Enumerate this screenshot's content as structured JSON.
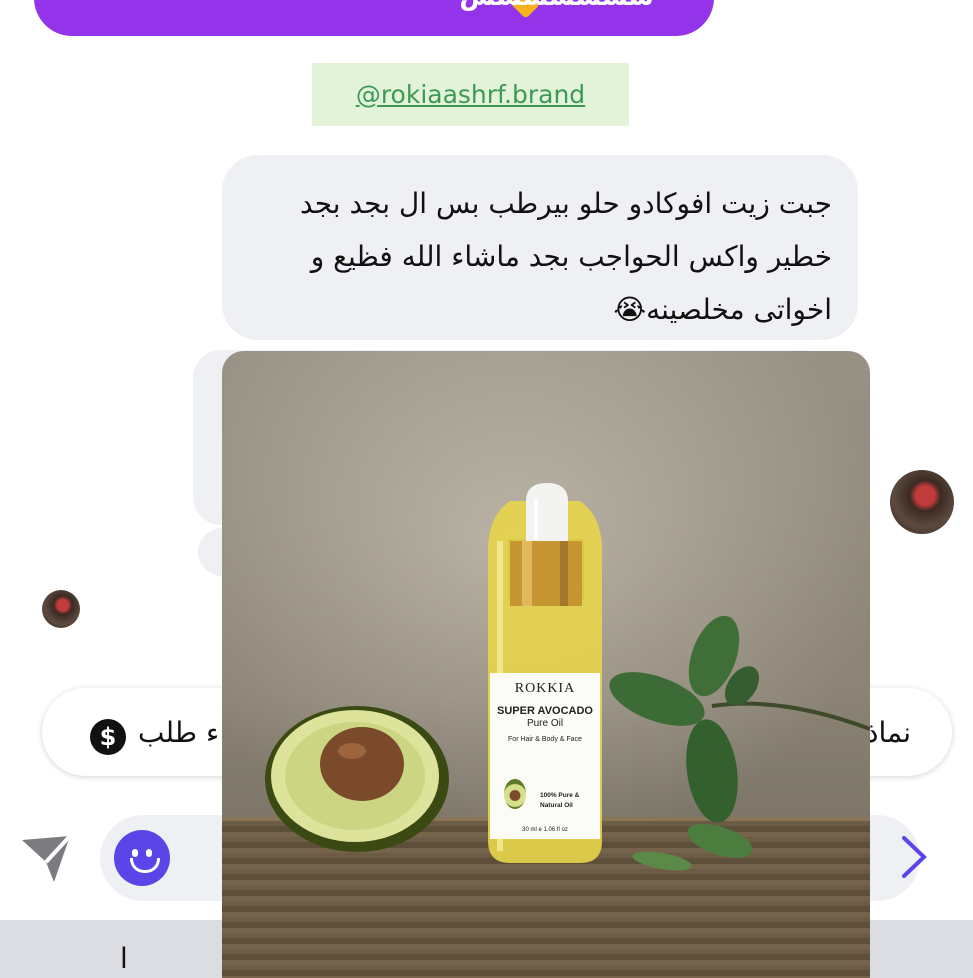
{
  "top_message": {
    "text": "سسسسسسس",
    "accent_color": "#9333ea"
  },
  "brand_link": {
    "text": "@rokiaashrf.brand",
    "color": "#3d9a54"
  },
  "incoming_message": {
    "lines": [
      "جبت زيت افوكادو حلو بيرطب بس ال بجد بجد",
      "خطير واكس الحواجب بجد ماشاء الله فظيع و",
      "اخواتى مخلصينه😭"
    ]
  },
  "product_photo": {
    "brand": "ROKKIA",
    "product_name": "SUPER AVOCADO",
    "product_type": "Pure Oil",
    "usage": "For Hair & Body & Face",
    "purity": "100% Pure & Natural Oil",
    "volume": "30 ml e 1.06 fl oz"
  },
  "action_row": {
    "order_label": "ء طلب",
    "samples_label": "نماذ",
    "dollar_icon": "dollar-icon"
  },
  "composer": {
    "emoji_icon": "smiley-icon",
    "send_icon": "paper-plane-icon",
    "chevron_icon": "chevron-right-icon",
    "accent_color": "#5b44e8"
  },
  "bottom_bar": {
    "fragment": "ا"
  }
}
